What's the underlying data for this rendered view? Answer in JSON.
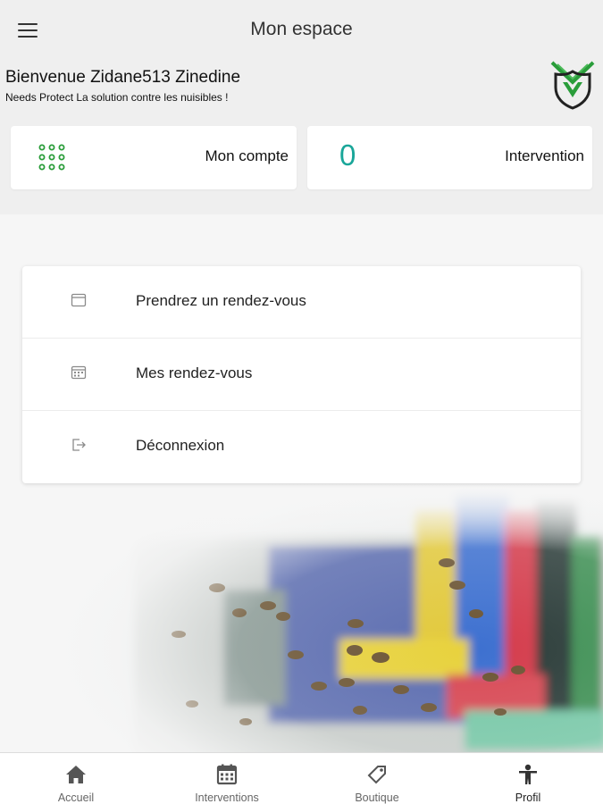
{
  "header": {
    "title": "Mon espace",
    "menu_icon": "hamburger-menu-icon"
  },
  "welcome": {
    "title": "Bienvenue Zidane513 Zinedine",
    "subtitle": "Needs Protect La solution contre les nuisibles !"
  },
  "logo": {
    "icon": "needs-protect-shield-logo",
    "color": "#2a9d3a"
  },
  "cards": {
    "account": {
      "label": "Mon compte",
      "icon": "grid-dots-icon",
      "icon_color": "#2a9d3a"
    },
    "interventions": {
      "count": "0",
      "label": "Intervention",
      "count_color": "#19a699"
    }
  },
  "menu": {
    "items": [
      {
        "label": "Prendrez un rendez-vous",
        "icon": "calendar-icon"
      },
      {
        "label": "Mes rendez-vous",
        "icon": "calendar-grid-icon"
      },
      {
        "label": "Déconnexion",
        "icon": "logout-icon"
      }
    ]
  },
  "bottom_nav": {
    "items": [
      {
        "label": "Accueil",
        "icon": "home-icon"
      },
      {
        "label": "Interventions",
        "icon": "calendar-icon"
      },
      {
        "label": "Boutique",
        "icon": "tag-icon"
      },
      {
        "label": "Profil",
        "icon": "person-icon"
      }
    ],
    "active": "Profil"
  },
  "hero": {
    "image": "beehive-with-bees-photo"
  }
}
